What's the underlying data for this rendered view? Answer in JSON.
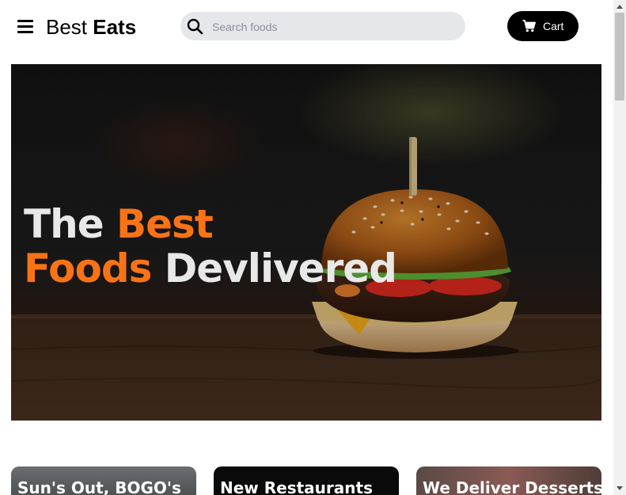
{
  "header": {
    "logo_prefix": "Best ",
    "logo_bold": "Eats",
    "search": {
      "placeholder": "Search foods",
      "value": ""
    },
    "cart_label": "Cart"
  },
  "hero": {
    "line1_plain": "The ",
    "line1_accent": "Best",
    "line2_accent": "Foods",
    "line2_plain": " Devlivered",
    "accent_color": "#f97316"
  },
  "cards": [
    {
      "title": "Sun's Out, BOGO's"
    },
    {
      "title": "New Restaurants"
    },
    {
      "title": "We Deliver Desserts"
    }
  ],
  "icons": {
    "menu": "hamburger-menu-icon",
    "search": "search-icon",
    "cart": "shopping-cart-icon"
  }
}
